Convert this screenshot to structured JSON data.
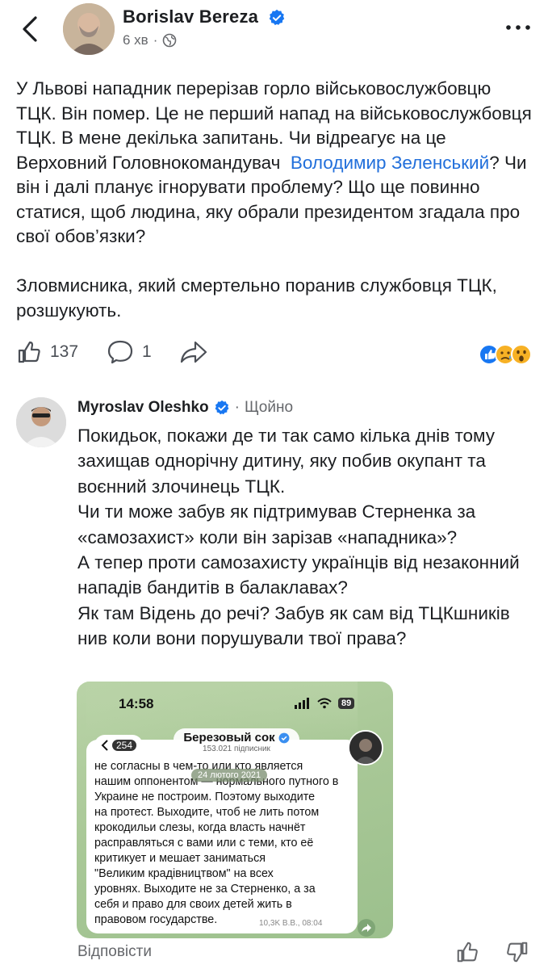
{
  "header": {
    "back_label": "Back",
    "author": "Borislav Bereza",
    "time": "6 хв"
  },
  "post": {
    "text_before": "У Львові нападник перерізав горло військовослужбовцю ТЦК. Він помер. Це не перший напад на військовослужбовця ТЦК. В мене декілька запитань. Чи відреагує на це Верховний Головнокомандувач  ",
    "mention": "Володимир Зеленський",
    "text_after": "? Чи він і далі планує ігнорувати проблему? Що ще повинно статися, щоб людина, яку обрали президентом згадала про свої обов’язки?\n\nЗловмисника, який смертельно поранив службовця ТЦК, розшукують."
  },
  "actions": {
    "likes": "137",
    "comments": "1"
  },
  "comment": {
    "author": "Myroslav Oleshko",
    "dot": "·",
    "time": "Щойно",
    "text": "Покидьок, покажи де ти так само кілька днів тому захищав однорічну дитину, яку побив окупант та воєнний злочинець ТЦК.\nЧи ти може забув як підтримував Стерненка за «самозахист» коли він зарізав «нападника»?\nА тепер проти самозахисту українців від незаконний нападів бандитів в балаклавах?\nЯк там Відень до речі? Забув як сам від ТЦКшників нив коли вони порушували твої права?",
    "reply_label": "Відповісти"
  },
  "screenshot": {
    "time": "14:58",
    "battery": "89",
    "back_count": "254",
    "channel_name": "Березовый сок",
    "subscribers": "153.021 підписник",
    "date_badge": "24 лютого 2021",
    "text": "не согласны в чем-то или кто является\nнашим оппонентом — нормального путного в\nУкраине не построим. Поэтому выходите\nна протест. Выходите, чтоб не лить потом\nкрокодильи слезы, когда власть начнёт\nрасправляться с вами или с теми, кто её\nкритикует и мешает заниматься\n\"Великим крадівництвом\" на всех\nуровнях. Выходите не за Стерненко, а за\nсебя и право для своих детей жить в\nправовом государстве.",
    "views": "10,3K В.В., 08:04"
  },
  "colors": {
    "link": "#216fdb",
    "verified": "#1877f2",
    "secondary_text": "#65676b"
  }
}
